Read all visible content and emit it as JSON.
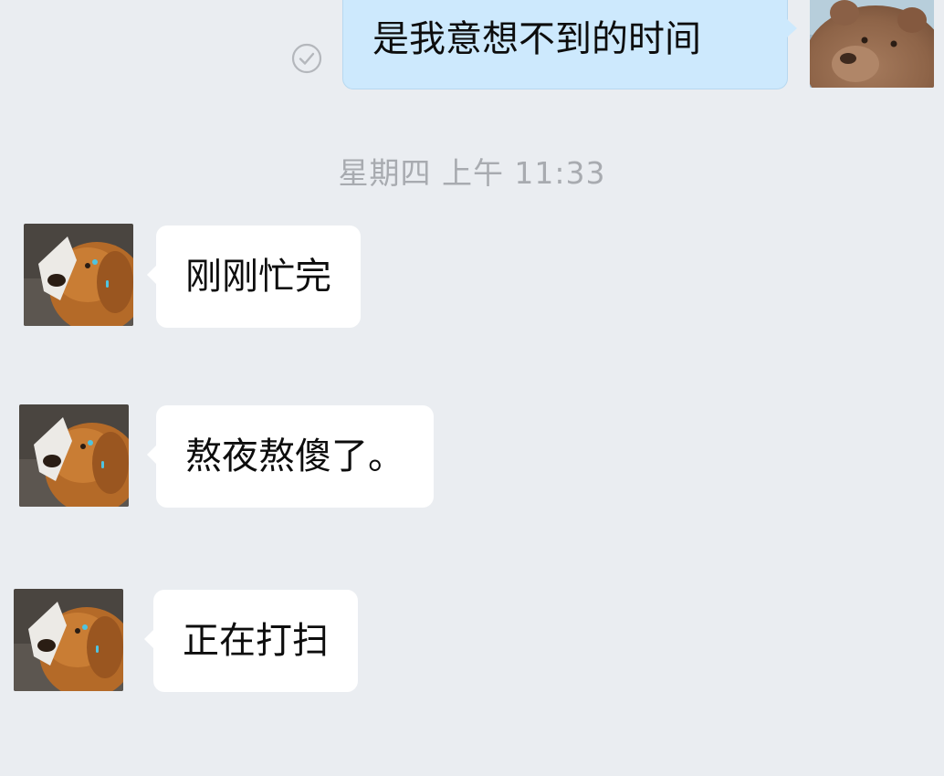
{
  "colors": {
    "background": "#eaedf1",
    "outgoing_bubble": "#cde9fd",
    "incoming_bubble": "#ffffff",
    "timestamp_text": "#a8abb0",
    "read_check": "#b4b7bc"
  },
  "outgoing": {
    "message": "是我意想不到的时间",
    "status_icon": "check-circle-icon",
    "avatar": "brown-bear-avatar"
  },
  "timestamp": "星期四 上午 11:33",
  "incoming": [
    {
      "text": "刚刚忙完",
      "avatar": "golden-retriever-avatar"
    },
    {
      "text": "熬夜熬傻了。",
      "avatar": "golden-retriever-avatar"
    },
    {
      "text": "正在打扫",
      "avatar": "golden-retriever-avatar"
    }
  ]
}
